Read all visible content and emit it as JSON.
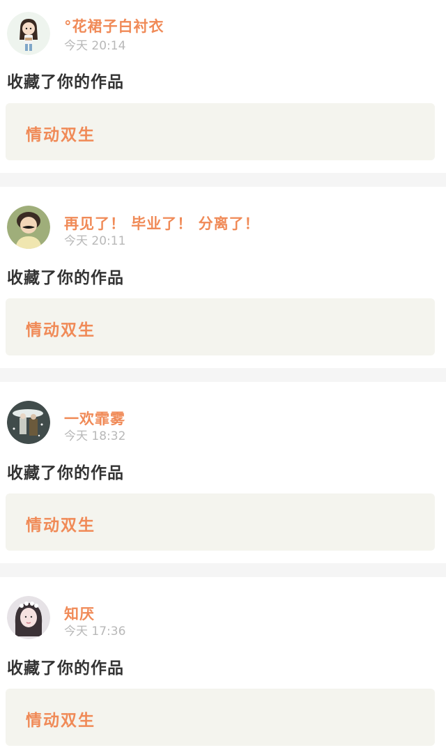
{
  "notifications": [
    {
      "username": "°花裙子白衬衣",
      "time": "今天 20:14",
      "action": "收藏了你的作品",
      "work_title": "情动双生",
      "avatar_icon": "cartoon-girl-avatar-icon"
    },
    {
      "username": "再见了！ 毕业了！ 分离了！",
      "time": "今天 20:11",
      "action": "收藏了你的作品",
      "work_title": "情动双生",
      "avatar_icon": "boy-mustache-avatar-icon"
    },
    {
      "username": "一欢霏雾",
      "time": "今天 18:32",
      "action": "收藏了你的作品",
      "work_title": "情动双生",
      "avatar_icon": "snowy-couple-avatar-icon"
    },
    {
      "username": "知厌",
      "time": "今天 17:36",
      "action": "收藏了你的作品",
      "work_title": "情动双生",
      "avatar_icon": "girl-portrait-avatar-icon"
    }
  ],
  "colors": {
    "accent": "#f08a57",
    "time": "#b8b8b8",
    "action_text": "#333333",
    "card_bg": "#f4f4ee",
    "separator": "#f5f5f5"
  }
}
